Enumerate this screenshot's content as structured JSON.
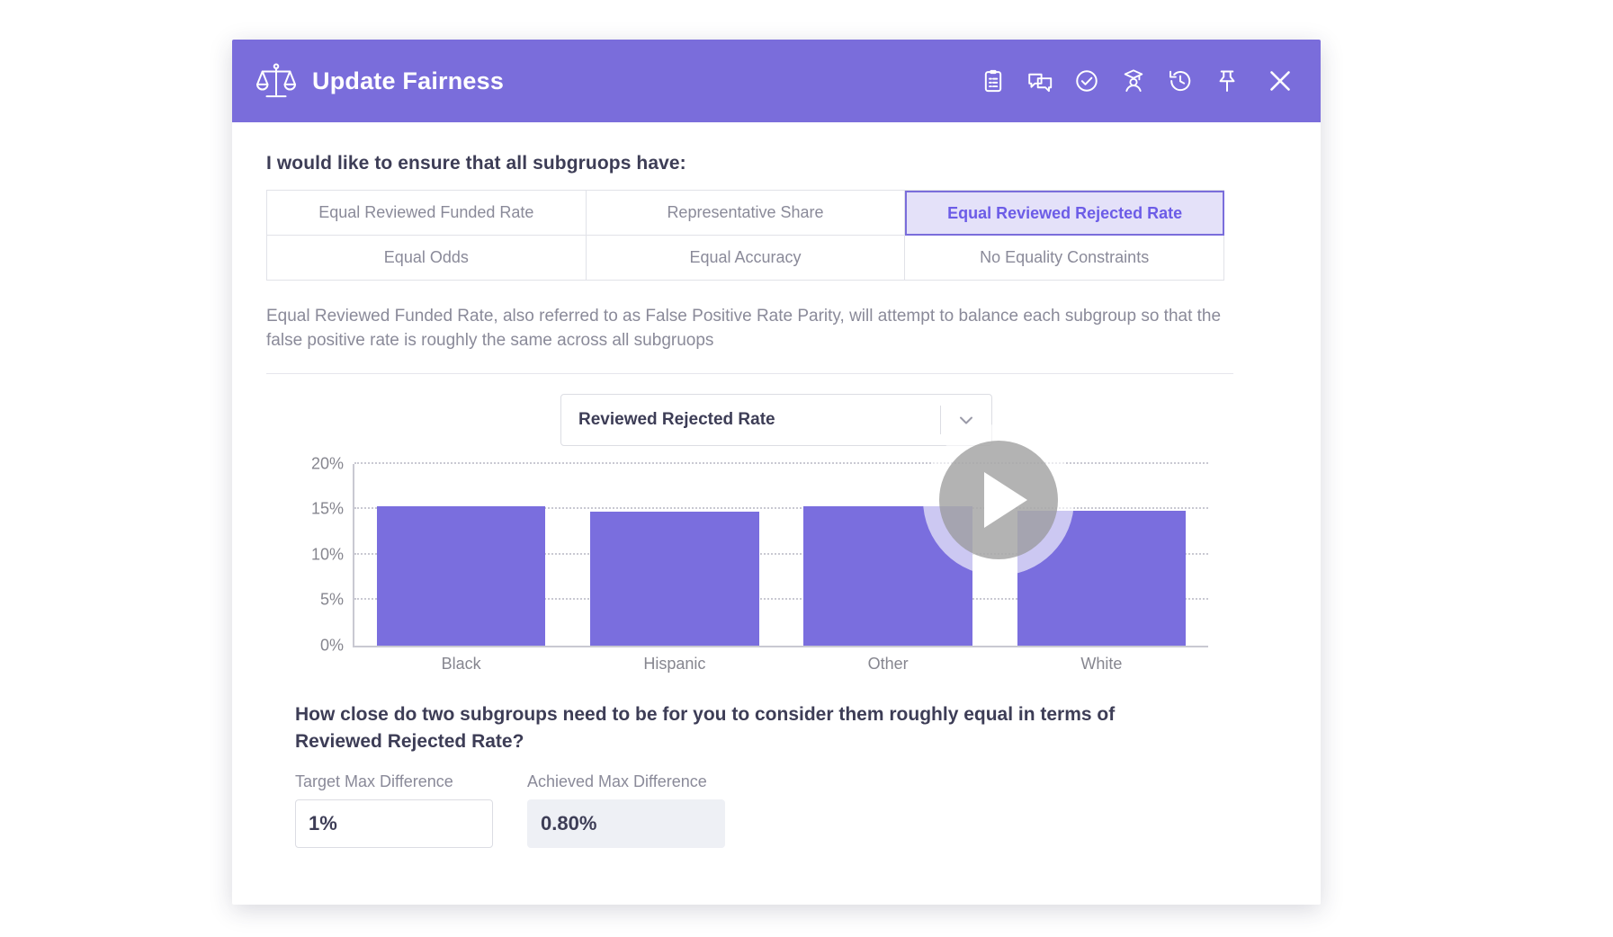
{
  "header": {
    "title": "Update Fairness",
    "logo_icon": "scales-balance-icon",
    "icons": [
      {
        "name": "clipboard-tasks-icon",
        "label": "Notes"
      },
      {
        "name": "chat-bubbles-icon",
        "label": "Comments"
      },
      {
        "name": "check-circle-icon",
        "label": "Approve"
      },
      {
        "name": "graduate-user-icon",
        "label": "Learn"
      },
      {
        "name": "history-clock-icon",
        "label": "History"
      },
      {
        "name": "pin-icon",
        "label": "Pin"
      },
      {
        "name": "close-x-icon",
        "label": "Close"
      }
    ]
  },
  "section": {
    "heading": "I would like to ensure that all subgruops have:",
    "tabs": [
      {
        "label": "Equal Reviewed Funded Rate",
        "selected": false
      },
      {
        "label": "Representative Share",
        "selected": false
      },
      {
        "label": "Equal Reviewed Rejected Rate",
        "selected": true
      },
      {
        "label": "Equal Odds",
        "selected": false
      },
      {
        "label": "Equal Accuracy",
        "selected": false
      },
      {
        "label": "No Equality Constraints",
        "selected": false
      }
    ],
    "description": "Equal Reviewed Funded Rate, also referred to as False Positive Rate Parity, will attempt to balance each subgroup so that the false positive rate is roughly the same across all subgruops"
  },
  "metric_select": {
    "value": "Reviewed Rejected Rate",
    "arrow_icon": "chevron-down-icon"
  },
  "media": {
    "play_label": "Play"
  },
  "chart_data": {
    "type": "bar",
    "title": "",
    "xlabel": "",
    "ylabel": "",
    "categories": [
      "Black",
      "Hispanic",
      "Other",
      "White"
    ],
    "values": [
      15.3,
      14.7,
      15.3,
      14.8
    ],
    "ylim": [
      0,
      20
    ],
    "yticks": [
      0,
      5,
      10,
      15,
      20
    ],
    "ytick_labels": [
      "0%",
      "5%",
      "10%",
      "15%",
      "20%"
    ],
    "grid": true,
    "legend": "none",
    "bar_color": "#7a6ede",
    "series": [
      {
        "name": "Reviewed Rejected Rate",
        "values": [
          15.3,
          14.7,
          15.3,
          14.8
        ]
      }
    ]
  },
  "threshold": {
    "question": "How close do two subgroups need to be for you to consider them roughly equal in terms of Reviewed Rejected Rate?",
    "target_label": "Target Max Difference",
    "target_value": "1%",
    "target_placeholder": "1%",
    "achieved_label": "Achieved Max Difference",
    "achieved_value": "0.80%"
  },
  "colors": {
    "header_purple": "#7a6ddb",
    "accent_purple": "#6c5ce7",
    "bar_purple": "#7a6ede",
    "selected_tab_bg": "#e4e1f9",
    "text_dark": "#3d3d56",
    "text_muted": "#8a8a99"
  }
}
